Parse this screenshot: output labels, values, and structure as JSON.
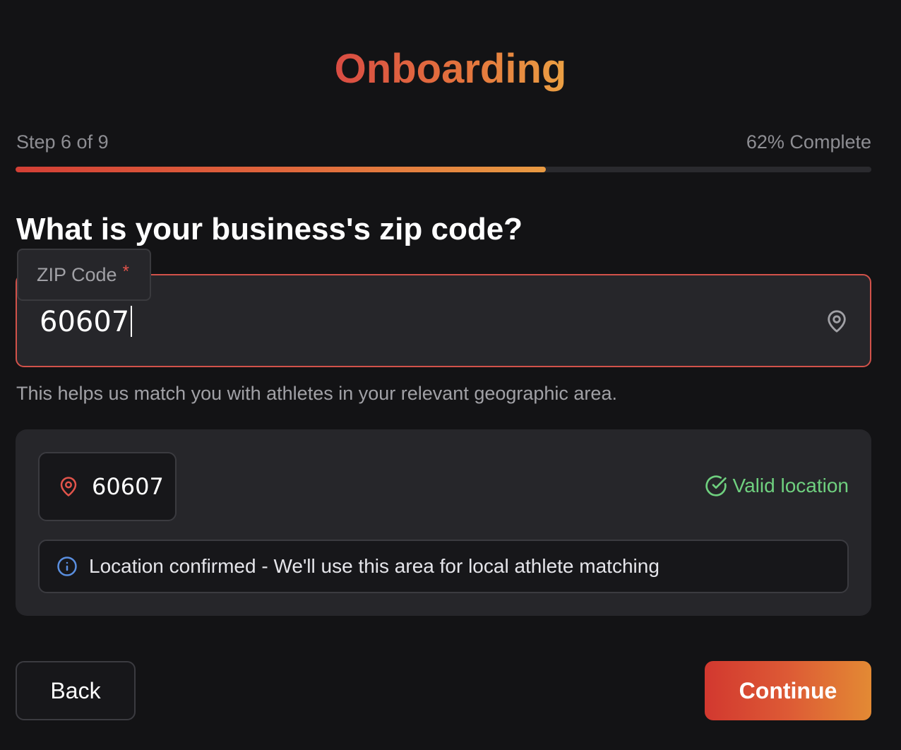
{
  "header": {
    "title": "Onboarding"
  },
  "progress": {
    "step_label": "Step 6 of 9",
    "percent_label": "62% Complete",
    "fraction": 0.62
  },
  "question": {
    "text": "What is your business's zip code?"
  },
  "zip_field": {
    "label": "ZIP Code",
    "required_marker": "*",
    "value": "60607",
    "icon": "map-pin-icon",
    "helper_text": "This helps us match you with athletes in your relevant geographic area."
  },
  "result": {
    "zip_value": "60607",
    "zip_icon": "map-pin-icon",
    "status_text": "Valid location",
    "status_icon": "check-circle-icon",
    "status_color": "#6fd07f",
    "info_text": "Location confirmed - We'll use this area for local athlete matching",
    "info_icon": "info-icon"
  },
  "actions": {
    "back_label": "Back",
    "continue_label": "Continue"
  },
  "colors": {
    "accent_start": "#d2382f",
    "accent_end": "#e38a34",
    "background": "#131315",
    "error_border": "#d2524a",
    "info_blue": "#5a8fe0"
  }
}
